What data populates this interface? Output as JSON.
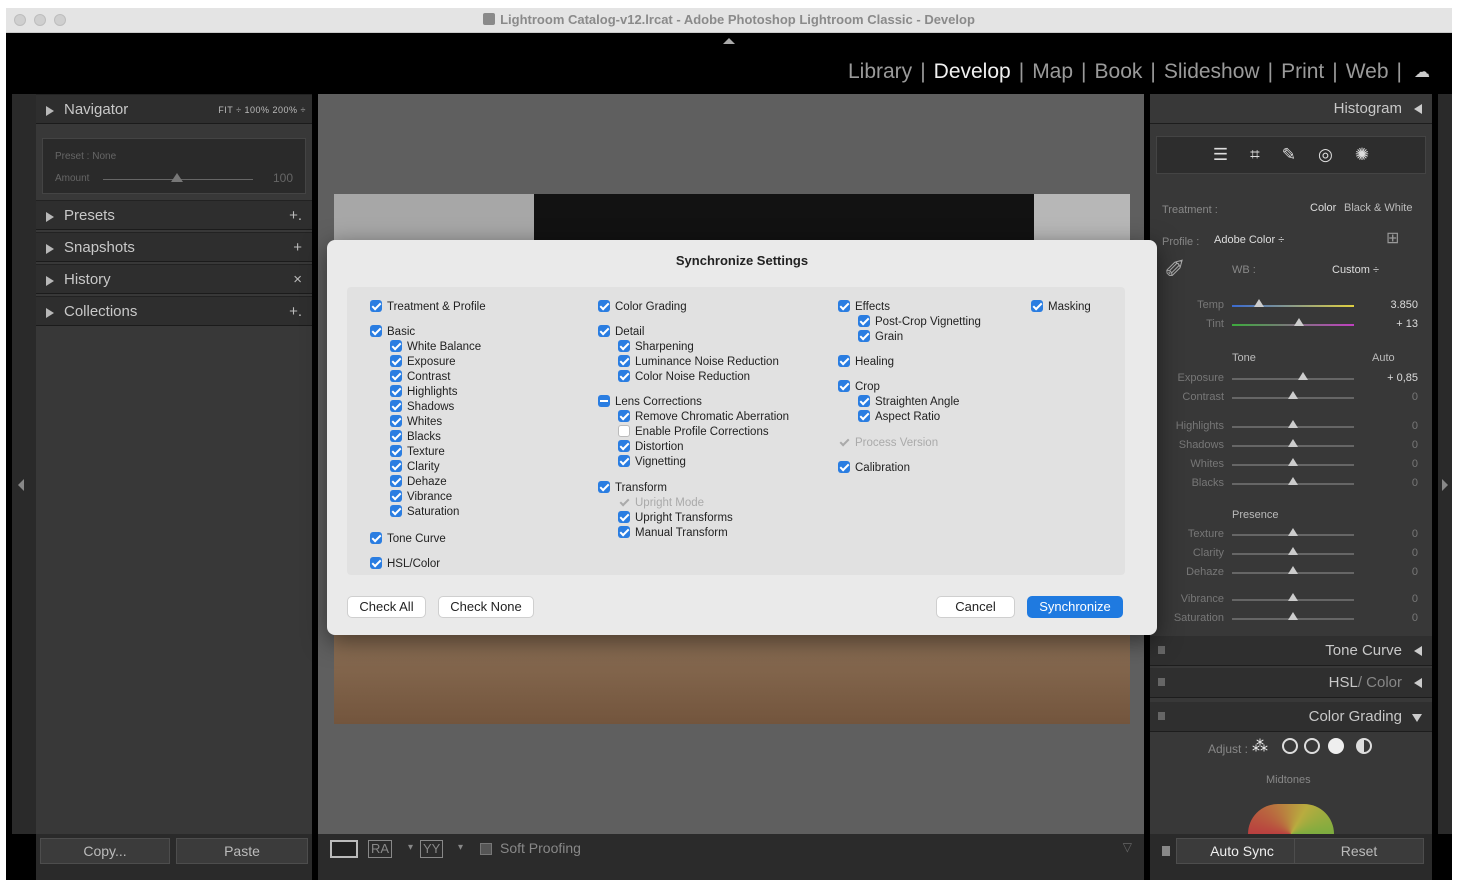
{
  "window": {
    "title": "Lightroom Catalog-v12.lrcat - Adobe Photoshop Lightroom Classic - Develop"
  },
  "modules": {
    "items": [
      "Library",
      "Develop",
      "Map",
      "Book",
      "Slideshow",
      "Print",
      "Web"
    ],
    "active": "Develop",
    "separator": "|"
  },
  "left_panel": {
    "navigator": {
      "label": "Navigator",
      "zoom": "FIT ÷  100%  200% ÷"
    },
    "preset_preview": {
      "preset": "Preset : None",
      "amount_label": "Amount",
      "amount_value": "100"
    },
    "sections": [
      {
        "label": "Presets",
        "action": "+."
      },
      {
        "label": "Snapshots",
        "action": "+"
      },
      {
        "label": "History",
        "action": "×"
      },
      {
        "label": "Collections",
        "action": "+."
      }
    ],
    "copy_label": "Copy...",
    "paste_label": "Paste"
  },
  "toolbar": {
    "soft_proofing": "Soft Proofing",
    "view_ra": "RA",
    "view_yy": "YY"
  },
  "right_panel": {
    "histogram_label": "Histogram",
    "treatment_label": "Treatment :",
    "treatment_color": "Color",
    "treatment_bw": "Black & White",
    "profile_label": "Profile :",
    "profile_value": "Adobe Color ÷",
    "wb_label": "WB :",
    "wb_value": "Custom ÷",
    "temp": {
      "label": "Temp",
      "value": "3.850",
      "pos": 0.22
    },
    "tint": {
      "label": "Tint",
      "value": "+ 13",
      "pos": 0.55
    },
    "tone_label": "Tone",
    "auto_label": "Auto",
    "tone_sliders": [
      {
        "label": "Exposure",
        "value": "+ 0,85",
        "pos": 0.58
      },
      {
        "label": "Contrast",
        "value": "0",
        "pos": 0.5
      },
      {
        "label": "Highlights",
        "value": "0",
        "pos": 0.5
      },
      {
        "label": "Shadows",
        "value": "0",
        "pos": 0.5
      },
      {
        "label": "Whites",
        "value": "0",
        "pos": 0.5
      },
      {
        "label": "Blacks",
        "value": "0",
        "pos": 0.5
      }
    ],
    "presence_label": "Presence",
    "presence_sliders": [
      {
        "label": "Texture",
        "value": "0",
        "pos": 0.5
      },
      {
        "label": "Clarity",
        "value": "0",
        "pos": 0.5
      },
      {
        "label": "Dehaze",
        "value": "0",
        "pos": 0.5
      },
      {
        "label": "Vibrance",
        "value": "0",
        "pos": 0.5
      },
      {
        "label": "Saturation",
        "value": "0",
        "pos": 0.5
      }
    ],
    "tone_curve_label": "Tone Curve",
    "hsl_label": "HSL",
    "hsl_color": "/ Color",
    "color_grading_label": "Color Grading",
    "adjust_label": "Adjust :",
    "midtones_label": "Midtones",
    "auto_sync_label": "Auto Sync",
    "reset_label": "Reset"
  },
  "dialog": {
    "title": "Synchronize Settings",
    "col1": {
      "treatment": "Treatment & Profile",
      "basic": "Basic",
      "basic_items": [
        "White Balance",
        "Exposure",
        "Contrast",
        "Highlights",
        "Shadows",
        "Whites",
        "Blacks",
        "Texture",
        "Clarity",
        "Dehaze",
        "Vibrance",
        "Saturation"
      ],
      "tone_curve": "Tone Curve",
      "hsl": "HSL/Color"
    },
    "col2": {
      "color_grading": "Color Grading",
      "detail": "Detail",
      "detail_items": [
        "Sharpening",
        "Luminance Noise Reduction",
        "Color Noise Reduction"
      ],
      "lens": "Lens Corrections",
      "lens_items": [
        "Remove Chromatic Aberration",
        "Enable Profile Corrections",
        "Distortion",
        "Vignetting"
      ],
      "transform": "Transform",
      "transform_items": [
        "Upright Mode",
        "Upright Transforms",
        "Manual Transform"
      ]
    },
    "col3": {
      "effects": "Effects",
      "effects_items": [
        "Post-Crop Vignetting",
        "Grain"
      ],
      "healing": "Healing",
      "crop": "Crop",
      "crop_items": [
        "Straighten Angle",
        "Aspect Ratio"
      ],
      "process": "Process Version",
      "calibration": "Calibration"
    },
    "col4": {
      "masking": "Masking"
    },
    "check_all": "Check All",
    "check_none": "Check None",
    "cancel": "Cancel",
    "synchronize": "Synchronize"
  }
}
